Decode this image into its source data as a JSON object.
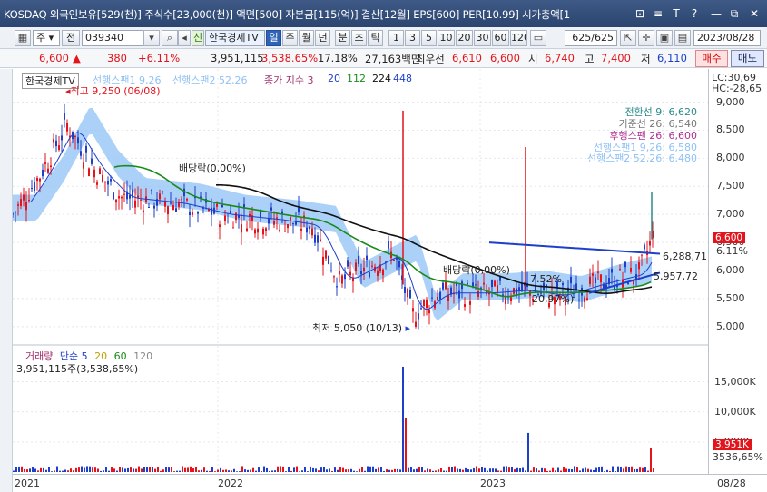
{
  "window": {
    "title": "KOSDAQ 외국인보유[529(천)] 주식수[23,000(천)] 액면[500] 자본금[115(억)] 결산[12월] EPS[600] PER[10.99] 시가총액[1",
    "buttons": [
      "⊡",
      "≡",
      "T",
      "?",
      "—",
      "⧉",
      "✕"
    ]
  },
  "toolbar": {
    "market_select": "주",
    "prev_label": "전",
    "code": "039340",
    "broker_badge": "신",
    "stock_name": "한국경제TV",
    "period_buttons": [
      "일",
      "주",
      "월",
      "년",
      "분",
      "초",
      "틱"
    ],
    "active_period": "일",
    "interval_buttons": [
      "1",
      "3",
      "5",
      "10",
      "20",
      "30",
      "60",
      "120"
    ],
    "count": "625/625",
    "date": "2023/08/28"
  },
  "price": {
    "current": "6,600",
    "arrow": "▲",
    "change": "380",
    "change_pct": "+6.11%",
    "volume": "3,951,115",
    "volume_pct": "3,538.65%",
    "turnover": "17.18%",
    "amount": "27,163백만",
    "best_ask_label": "최우선",
    "best_ask": "6,610",
    "best_bid": "6,600",
    "open_label": "시",
    "open": "6,740",
    "high_label": "고",
    "high": "7,400",
    "low_label": "저",
    "low": "6,110",
    "buy_label": "매수",
    "sell_label": "매도"
  },
  "chart_legend": {
    "name": "한국경제TV",
    "items": [
      {
        "text": "선행스팬1 9,26",
        "color": "#8fc1f5"
      },
      {
        "text": "선행스팬2 52,26",
        "color": "#8fc1f5"
      },
      {
        "text": "종가 지수 3",
        "color": "#a0306e"
      },
      {
        "text": "20",
        "color": "#1d3fc9"
      },
      {
        "text": "112",
        "color": "#1a8a1a"
      },
      {
        "text": "224",
        "color": "#111111"
      },
      {
        "text": "448",
        "color": "#1d3fc9"
      }
    ],
    "ichimoku": [
      {
        "text": "전환선 9: 6,620",
        "color": "#2a8a8a"
      },
      {
        "text": "기준선 26: 6,540",
        "color": "#777777"
      },
      {
        "text": "후행스팬 26: 6,600",
        "color": "#b03090"
      },
      {
        "text": "선행스팬1 9,26: 6,580",
        "color": "#8fc1f5"
      },
      {
        "text": "선행스팬2 52,26: 6,480",
        "color": "#8fc1f5"
      }
    ]
  },
  "annotations": {
    "high": "최고 9,250 (06/08)",
    "low": "최저 5,050 (10/13)",
    "dividend1": "배당락(0,00%)",
    "dividend2": "배당락(0,00%)",
    "trend_upper": "6,288,71",
    "trend_lower": "5,957,72",
    "mid1": "20,97%)",
    "mid2": "7.52%"
  },
  "price_axis": {
    "ticks": [
      "9,000",
      "8,500",
      "8,000",
      "7,500",
      "7,000",
      "6,500",
      "6,000",
      "5,500",
      "5,000"
    ],
    "lc": "LC:30,69",
    "hc": "HC:-28,65",
    "current_tag": "6,600",
    "current_pct": "6.11%"
  },
  "volume_panel": {
    "legend_label": "거래량",
    "legend_ma_label": "단순",
    "ma": [
      "5",
      "20",
      "60",
      "120"
    ],
    "value": "3,951,115주(3,538,65%)",
    "ticks": [
      "15,000K",
      "10,000K",
      "5,000K"
    ],
    "current_tag": "3,951K",
    "current_pct": "3536,65%"
  },
  "x_axis": {
    "labels": [
      "2021",
      "2022",
      "2023",
      "08/28"
    ]
  },
  "colors": {
    "up": "#e3141c",
    "down": "#1d3fc9",
    "cloud": "#8fc1f5",
    "ma20": "#1d3fc9",
    "ma112": "#1a8a1a",
    "ma224": "#111111"
  }
}
